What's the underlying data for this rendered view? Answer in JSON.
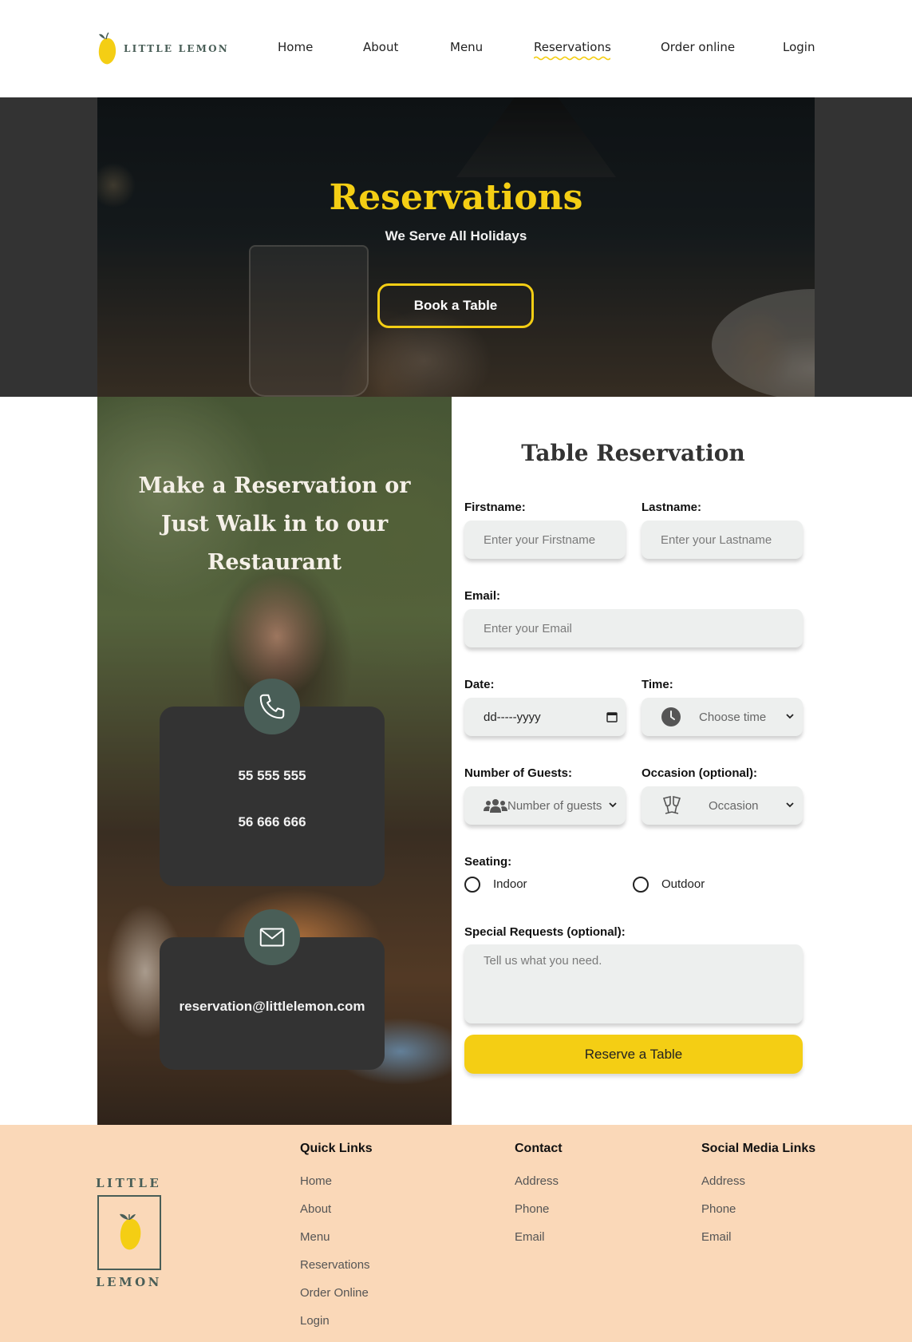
{
  "brand": {
    "logo_text": "LITTLE LEMON",
    "footer_logo_top": "LITTLE",
    "footer_logo_bottom": "LEMON"
  },
  "nav": {
    "items": [
      {
        "label": "Home"
      },
      {
        "label": "About"
      },
      {
        "label": "Menu"
      },
      {
        "label": "Reservations",
        "active": true
      },
      {
        "label": "Order online"
      },
      {
        "label": "Login"
      }
    ]
  },
  "hero": {
    "title": "Reservations",
    "subtitle": "We Serve All Holidays",
    "button_label": "Book a Table"
  },
  "contact_panel": {
    "title": "Make a Reservation or Just Walk in to our Restaurant",
    "phone_1": "55 555 555",
    "phone_2": "56 666 666",
    "email": "reservation@littlelemon.com"
  },
  "form": {
    "title": "Table Reservation",
    "firstname_label": "Firstname:",
    "firstname_placeholder": "Enter your Firstname",
    "lastname_label": "Lastname:",
    "lastname_placeholder": "Enter your Lastname",
    "email_label": "Email:",
    "email_placeholder": "Enter your Email",
    "date_label": "Date:",
    "date_value": "dd-----yyyy",
    "time_label": "Time:",
    "time_placeholder": "Choose time",
    "guests_label": "Number of Guests:",
    "guests_placeholder": "Number of guests",
    "occasion_label": "Occasion (optional):",
    "occasion_placeholder": "Occasion",
    "seating_label": "Seating:",
    "seating_options": [
      "Indoor",
      "Outdoor"
    ],
    "requests_label": "Special Requests (optional):",
    "requests_placeholder": "Tell us what you need.",
    "submit_label": "Reserve a Table"
  },
  "footer": {
    "quick_links": {
      "heading": "Quick Links",
      "items": [
        "Home",
        "About",
        "Menu",
        "Reservations",
        "Order Online",
        "Login"
      ]
    },
    "contact": {
      "heading": "Contact",
      "items": [
        "Address",
        "Phone",
        "Email"
      ]
    },
    "social": {
      "heading": "Social Media Links",
      "items": [
        "Address",
        "Phone",
        "Email"
      ]
    }
  },
  "colors": {
    "primary_green": "#495e57",
    "primary_yellow": "#f4ce14",
    "footer_peach": "#fad8b8",
    "dark": "#333333"
  },
  "icons": [
    "lemon-logo-icon",
    "phone-icon",
    "mail-icon",
    "clock-icon",
    "users-icon",
    "cheers-icon",
    "chevron-down-icon",
    "calendar-icon"
  ]
}
